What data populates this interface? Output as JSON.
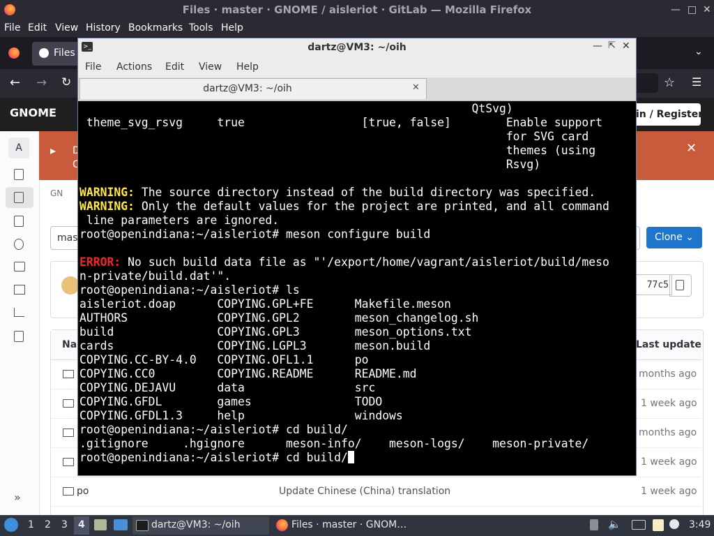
{
  "firefox": {
    "window_title": "Files · master · GNOME / aisleriot · GitLab — Mozilla Firefox",
    "menu": [
      "File",
      "Edit",
      "View",
      "History",
      "Bookmarks",
      "Tools",
      "Help"
    ],
    "tab_label": "Files"
  },
  "gitlab": {
    "logo": "GNOME",
    "signin": "in / Register",
    "sidebar_letter": "A",
    "banner_letters": [
      "D",
      "C"
    ],
    "breadcrumb": "GN",
    "branch_partial": "mas",
    "clone_label": "Clone",
    "sha_partial": "77c5",
    "table_header_name": "Nar",
    "table_header_update": "Last update",
    "rows": [
      {
        "name": "",
        "message": "",
        "time": "months ago"
      },
      {
        "name": "",
        "message": "",
        "time": "1 week ago"
      },
      {
        "name": "",
        "message": "",
        "time": "months ago"
      },
      {
        "name": "",
        "message": "",
        "time": "1 week ago"
      },
      {
        "name": "po",
        "message": "Update Chinese (China) translation",
        "time": "1 week ago"
      }
    ]
  },
  "terminal": {
    "title": "dartz@VM3: ~/oih",
    "menu": [
      "File",
      "Actions",
      "Edit",
      "View",
      "Help"
    ],
    "tab_label": "dartz@VM3: ~/oih",
    "lines": [
      {
        "text": "                                                         QtSvg)"
      },
      {
        "text": " theme_svg_rsvg     true                 [true, false]        Enable support"
      },
      {
        "text": "                                                              for SVG card"
      },
      {
        "text": "                                                              themes (using"
      },
      {
        "text": "                                                              Rsvg)"
      },
      {
        "text": ""
      },
      {
        "prefix": "WARNING:",
        "kind": "warn",
        "text": " The source directory instead of the build directory was specified."
      },
      {
        "prefix": "WARNING:",
        "kind": "warn",
        "text": " Only the default values for the project are printed, and all command"
      },
      {
        "text": " line parameters are ignored."
      },
      {
        "text": "root@openindiana:~/aisleriot# meson configure build"
      },
      {
        "text": ""
      },
      {
        "prefix": "ERROR:",
        "kind": "err",
        "text": " No such build data file as \"'/export/home/vagrant/aisleriot/build/meso"
      },
      {
        "text": "n-private/build.dat'\"."
      },
      {
        "text": "root@openindiana:~/aisleriot# ls"
      },
      {
        "text": "aisleriot.doap      COPYING.GPL+FE      Makefile.meson"
      },
      {
        "text": "AUTHORS             COPYING.GPL2        meson_changelog.sh"
      },
      {
        "text": "build               COPYING.GPL3        meson_options.txt"
      },
      {
        "text": "cards               COPYING.LGPL3       meson.build"
      },
      {
        "text": "COPYING.CC-BY-4.0   COPYING.OFL1.1      po"
      },
      {
        "text": "COPYING.CC0         COPYING.README      README.md"
      },
      {
        "text": "COPYING.DEJAVU      data                src"
      },
      {
        "text": "COPYING.GFDL        games               TODO"
      },
      {
        "text": "COPYING.GFDL1.3     help                windows"
      },
      {
        "text": "root@openindiana:~/aisleriot# cd build/"
      },
      {
        "text": ".gitignore     .hgignore      meson-info/    meson-logs/    meson-private/"
      }
    ],
    "prompt_line": "root@openindiana:~/aisleriot# cd build/"
  },
  "taskbar": {
    "workspaces": [
      "1",
      "2",
      "3",
      "4"
    ],
    "active_workspace": "4",
    "task_terminal": "dartz@VM3: ~/oih",
    "task_firefox": "Files · master · GNOM…",
    "clock": "3:49"
  },
  "colors": {
    "terminal_bg": "#000000",
    "warning": "#fce94f",
    "error": "#ef2929",
    "gitlab_blue": "#1f75cb",
    "banner": "#c85b3c"
  }
}
